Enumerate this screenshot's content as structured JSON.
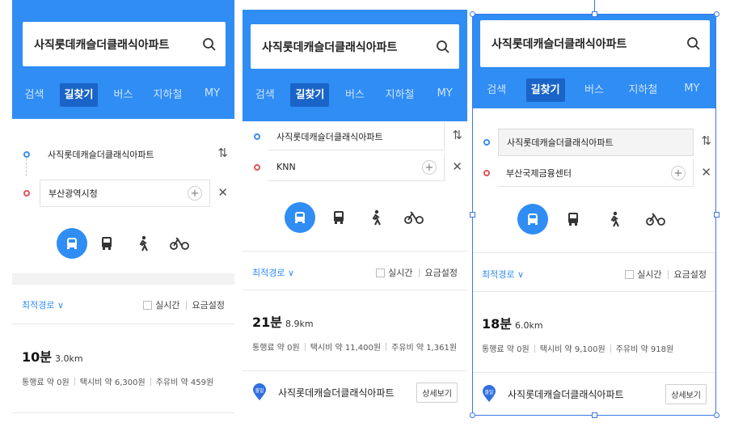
{
  "panels": [
    {
      "search_query": "사직롯데캐슬더클래식아파트",
      "tabs": [
        "검색",
        "길찾기",
        "버스",
        "지하철",
        "MY"
      ],
      "active_tab": 1,
      "origin": "사직롯데캐슬더클래식아파트",
      "destination": "부산광역시청",
      "route_option": "최적경로 ∨",
      "realtime_label": "실시간",
      "fare_label": "요금설정",
      "duration": "10분",
      "distance": "3.0km",
      "toll": "통행료 약 0원",
      "taxi": "택시비 약 6,300원",
      "fuel": "주유비 약 459원"
    },
    {
      "search_query": "사직롯데캐슬더클래식아파트",
      "tabs": [
        "검색",
        "길찾기",
        "버스",
        "지하철",
        "MY"
      ],
      "active_tab": 1,
      "origin": "사직롯데캐슬더클래식아파트",
      "destination": "KNN",
      "route_option": "최적경로 ∨",
      "realtime_label": "실시간",
      "fare_label": "요금설정",
      "duration": "21분",
      "distance": "8.9km",
      "toll": "통행료 약 0원",
      "taxi": "택시비 약 11,400원",
      "fuel": "주유비 약 1,361원",
      "start_pin_label": "출발",
      "start_name": "사직롯데캐슬더클래식아파트",
      "detail_button": "상세보기"
    },
    {
      "search_query": "사직롯데캐슬더클래식아파트",
      "tabs": [
        "검색",
        "길찾기",
        "버스",
        "지하철",
        "MY"
      ],
      "active_tab": 1,
      "origin": "사직롯데캐슬더클래식아파트",
      "destination": "부산국제금융센터",
      "route_option": "최적경로 ∨",
      "realtime_label": "실시간",
      "fare_label": "요금설정",
      "duration": "18분",
      "distance": "6.0km",
      "toll": "통행료 약 0원",
      "taxi": "택시비 약 9,100원",
      "fuel": "주유비 약 918원",
      "start_pin_label": "출발",
      "start_name": "사직롯데캐슬더클래식아파트",
      "detail_button": "상세보기"
    }
  ],
  "icons": {
    "search": "search-icon",
    "swap": "swap-icon",
    "clear": "close-icon",
    "add": "plus-icon",
    "car": "car-icon",
    "bus": "bus-icon",
    "walk": "walk-icon",
    "bike": "bike-icon",
    "pin": "start-pin-icon"
  },
  "colors": {
    "header_blue": "#2f8df4",
    "active_tab": "#1a64c8",
    "start_dot": "#3b8ef0",
    "end_dot": "#e0545c",
    "selection": "#3b78e7"
  }
}
